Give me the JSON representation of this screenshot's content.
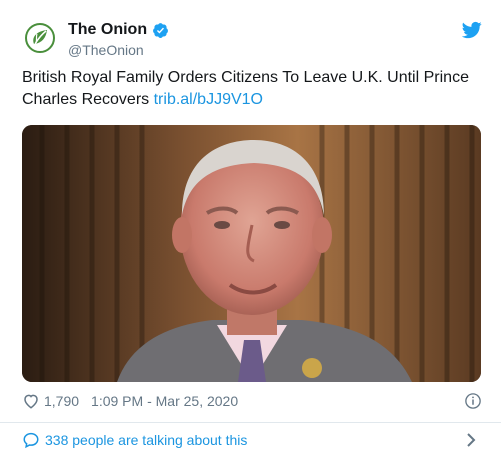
{
  "account": {
    "display_name": "The Onion",
    "handle": "@TheOnion",
    "avatar_icon": "onion-logo-icon",
    "verified_icon": "verified-badge-icon",
    "brand_color": "#1da1f2"
  },
  "tweet": {
    "text": "British Royal Family Orders Citizens To Leave U.K. Until Prince Charles Recovers ",
    "link_text": "trib.al/bJJ9V1O",
    "link_color": "#1b95e0"
  },
  "media": {
    "subject": "photo of an older man in a grey suit and pink shirt"
  },
  "meta": {
    "like_icon": "heart-icon",
    "like_count": "1,790",
    "timestamp": "1:09 PM - Mar 25, 2020",
    "info_icon": "info-icon"
  },
  "conversation": {
    "icon": "speech-bubble-icon",
    "text": "338 people are talking about this",
    "chevron_icon": "chevron-right-icon"
  }
}
